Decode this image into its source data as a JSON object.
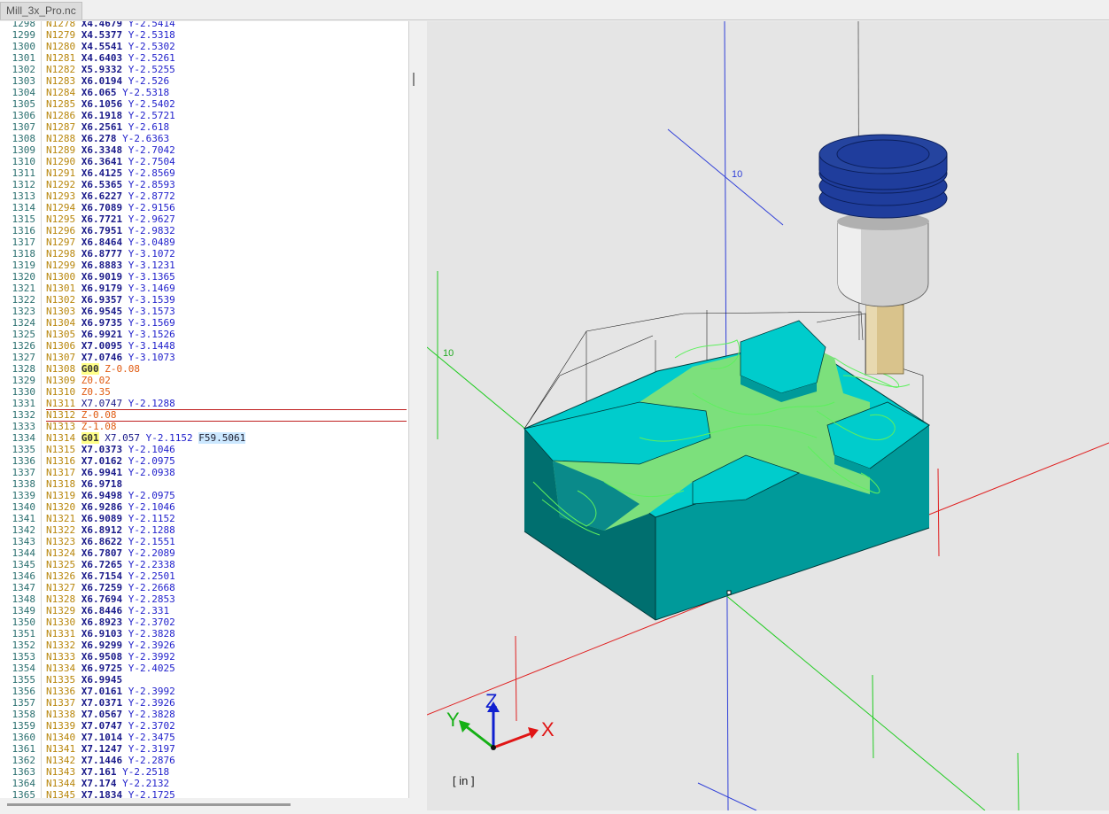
{
  "tab": {
    "title": "Mill_3x_Pro.nc"
  },
  "editor": {
    "lines": [
      {
        "num": "1298",
        "seq": "N1278",
        "x": "X4.4679",
        "y": "Y-2.5414"
      },
      {
        "num": "1299",
        "seq": "N1279",
        "x": "X4.5377",
        "y": "Y-2.5318"
      },
      {
        "num": "1300",
        "seq": "N1280",
        "x": "X4.5541",
        "y": "Y-2.5302"
      },
      {
        "num": "1301",
        "seq": "N1281",
        "x": "X4.6403",
        "y": "Y-2.5261"
      },
      {
        "num": "1302",
        "seq": "N1282",
        "x": "X5.9332",
        "y": "Y-2.5255"
      },
      {
        "num": "1303",
        "seq": "N1283",
        "x": "X6.0194",
        "y": "Y-2.526"
      },
      {
        "num": "1304",
        "seq": "N1284",
        "x": "X6.065",
        "y": "Y-2.5318"
      },
      {
        "num": "1305",
        "seq": "N1285",
        "x": "X6.1056",
        "y": "Y-2.5402"
      },
      {
        "num": "1306",
        "seq": "N1286",
        "x": "X6.1918",
        "y": "Y-2.5721"
      },
      {
        "num": "1307",
        "seq": "N1287",
        "x": "X6.2561",
        "y": "Y-2.618"
      },
      {
        "num": "1308",
        "seq": "N1288",
        "x": "X6.278",
        "y": "Y-2.6363"
      },
      {
        "num": "1309",
        "seq": "N1289",
        "x": "X6.3348",
        "y": "Y-2.7042"
      },
      {
        "num": "1310",
        "seq": "N1290",
        "x": "X6.3641",
        "y": "Y-2.7504"
      },
      {
        "num": "1311",
        "seq": "N1291",
        "x": "X6.4125",
        "y": "Y-2.8569"
      },
      {
        "num": "1312",
        "seq": "N1292",
        "x": "X6.5365",
        "y": "Y-2.8593"
      },
      {
        "num": "1313",
        "seq": "N1293",
        "x": "X6.6227",
        "y": "Y-2.8772"
      },
      {
        "num": "1314",
        "seq": "N1294",
        "x": "X6.7089",
        "y": "Y-2.9156"
      },
      {
        "num": "1315",
        "seq": "N1295",
        "x": "X6.7721",
        "y": "Y-2.9627"
      },
      {
        "num": "1316",
        "seq": "N1296",
        "x": "X6.7951",
        "y": "Y-2.9832"
      },
      {
        "num": "1317",
        "seq": "N1297",
        "x": "X6.8464",
        "y": "Y-3.0489"
      },
      {
        "num": "1318",
        "seq": "N1298",
        "x": "X6.8777",
        "y": "Y-3.1072"
      },
      {
        "num": "1319",
        "seq": "N1299",
        "x": "X6.8883",
        "y": "Y-3.1231"
      },
      {
        "num": "1320",
        "seq": "N1300",
        "x": "X6.9019",
        "y": "Y-3.1365"
      },
      {
        "num": "1321",
        "seq": "N1301",
        "x": "X6.9179",
        "y": "Y-3.1469"
      },
      {
        "num": "1322",
        "seq": "N1302",
        "x": "X6.9357",
        "y": "Y-3.1539"
      },
      {
        "num": "1323",
        "seq": "N1303",
        "x": "X6.9545",
        "y": "Y-3.1573"
      },
      {
        "num": "1324",
        "seq": "N1304",
        "x": "X6.9735",
        "y": "Y-3.1569"
      },
      {
        "num": "1325",
        "seq": "N1305",
        "x": "X6.9921",
        "y": "Y-3.1526"
      },
      {
        "num": "1326",
        "seq": "N1306",
        "x": "X7.0095",
        "y": "Y-3.1448"
      },
      {
        "num": "1327",
        "seq": "N1307",
        "x": "X7.0746",
        "y": "Y-3.1073"
      },
      {
        "num": "1328",
        "seq": "N1308",
        "g": "G00",
        "z": "Z-0.08"
      },
      {
        "num": "1329",
        "seq": "N1309",
        "z": "Z0.02"
      },
      {
        "num": "1330",
        "seq": "N1310",
        "z": "Z0.35"
      },
      {
        "num": "1331",
        "seq": "N1311",
        "p": "X7.0747",
        "y": "Y-2.1288"
      },
      {
        "num": "1332",
        "seq": "N1312",
        "z": "Z-0.08",
        "cursor": true
      },
      {
        "num": "1333",
        "seq": "N1313",
        "z": "Z-1.08"
      },
      {
        "num": "1334",
        "seq": "N1314",
        "g": "G01",
        "p": "X7.057",
        "y": "Y-2.1152",
        "f": "F59.5061"
      },
      {
        "num": "1335",
        "seq": "N1315",
        "x": "X7.0373",
        "y": "Y-2.1046"
      },
      {
        "num": "1336",
        "seq": "N1316",
        "x": "X7.0162",
        "y": "Y-2.0975"
      },
      {
        "num": "1337",
        "seq": "N1317",
        "x": "X6.9941",
        "y": "Y-2.0938"
      },
      {
        "num": "1338",
        "seq": "N1318",
        "x": "X6.9718"
      },
      {
        "num": "1339",
        "seq": "N1319",
        "x": "X6.9498",
        "y": "Y-2.0975"
      },
      {
        "num": "1340",
        "seq": "N1320",
        "x": "X6.9286",
        "y": "Y-2.1046"
      },
      {
        "num": "1341",
        "seq": "N1321",
        "x": "X6.9089",
        "y": "Y-2.1152"
      },
      {
        "num": "1342",
        "seq": "N1322",
        "x": "X6.8912",
        "y": "Y-2.1288"
      },
      {
        "num": "1343",
        "seq": "N1323",
        "x": "X6.8622",
        "y": "Y-2.1551"
      },
      {
        "num": "1344",
        "seq": "N1324",
        "x": "X6.7807",
        "y": "Y-2.2089"
      },
      {
        "num": "1345",
        "seq": "N1325",
        "x": "X6.7265",
        "y": "Y-2.2338"
      },
      {
        "num": "1346",
        "seq": "N1326",
        "x": "X6.7154",
        "y": "Y-2.2501"
      },
      {
        "num": "1347",
        "seq": "N1327",
        "x": "X6.7259",
        "y": "Y-2.2668"
      },
      {
        "num": "1348",
        "seq": "N1328",
        "x": "X6.7694",
        "y": "Y-2.2853"
      },
      {
        "num": "1349",
        "seq": "N1329",
        "x": "X6.8446",
        "y": "Y-2.331"
      },
      {
        "num": "1350",
        "seq": "N1330",
        "x": "X6.8923",
        "y": "Y-2.3702"
      },
      {
        "num": "1351",
        "seq": "N1331",
        "x": "X6.9103",
        "y": "Y-2.3828"
      },
      {
        "num": "1352",
        "seq": "N1332",
        "x": "X6.9299",
        "y": "Y-2.3926"
      },
      {
        "num": "1353",
        "seq": "N1333",
        "x": "X6.9508",
        "y": "Y-2.3992"
      },
      {
        "num": "1354",
        "seq": "N1334",
        "x": "X6.9725",
        "y": "Y-2.4025"
      },
      {
        "num": "1355",
        "seq": "N1335",
        "x": "X6.9945"
      },
      {
        "num": "1356",
        "seq": "N1336",
        "x": "X7.0161",
        "y": "Y-2.3992"
      },
      {
        "num": "1357",
        "seq": "N1337",
        "x": "X7.0371",
        "y": "Y-2.3926"
      },
      {
        "num": "1358",
        "seq": "N1338",
        "x": "X7.0567",
        "y": "Y-2.3828"
      },
      {
        "num": "1359",
        "seq": "N1339",
        "x": "X7.0747",
        "y": "Y-2.3702"
      },
      {
        "num": "1360",
        "seq": "N1340",
        "x": "X7.1014",
        "y": "Y-2.3475"
      },
      {
        "num": "1361",
        "seq": "N1341",
        "x": "X7.1247",
        "y": "Y-2.3197"
      },
      {
        "num": "1362",
        "seq": "N1342",
        "x": "X7.1446",
        "y": "Y-2.2876"
      },
      {
        "num": "1363",
        "seq": "N1343",
        "x": "X7.161",
        "y": "Y-2.2518"
      },
      {
        "num": "1364",
        "seq": "N1344",
        "x": "X7.174",
        "y": "Y-2.2132"
      },
      {
        "num": "1365",
        "seq": "N1345",
        "x": "X7.1834",
        "y": "Y-2.1725"
      }
    ]
  },
  "viewport": {
    "axis_labels": {
      "x": "X",
      "y": "Y",
      "z": "Z"
    },
    "grid_label_top": "10",
    "grid_label_left": "10",
    "units": "[ in ]",
    "colors": {
      "stock": "#00cccc",
      "stock_side": "#009a9a",
      "stock_dark": "#006f6f",
      "toolpath": "#5ef05e",
      "holder": "#1f3d9c",
      "tool_shank": "#cfcfcf",
      "tool_bit": "#d9c38c"
    },
    "icons": [
      "axis-triad-icon"
    ]
  }
}
